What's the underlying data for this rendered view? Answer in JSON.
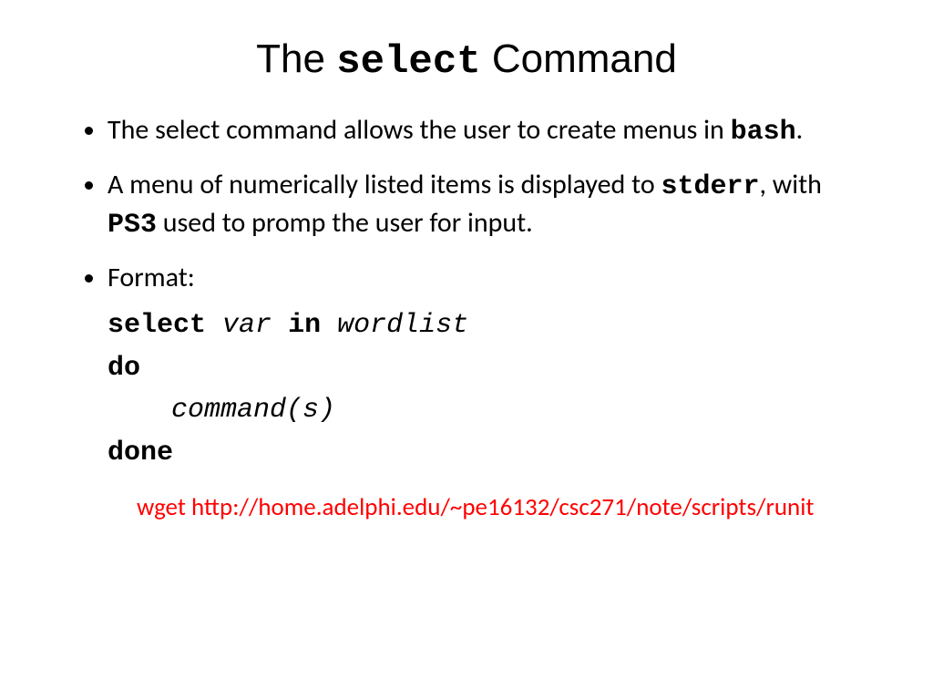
{
  "title": {
    "pre": "The ",
    "code": "select",
    "post": " Command"
  },
  "bullets": {
    "b1": {
      "t1": "The select command allows the user to create menus in ",
      "c1": "bash",
      "t2": "."
    },
    "b2": {
      "t1": "A menu of numerically listed items is displayed to ",
      "c1": "stderr",
      "t2": ", with ",
      "c2": "PS3",
      "t3": " used to promp the user for input."
    },
    "b3": {
      "t1": "Format:"
    }
  },
  "code": {
    "l1_kw1": "select",
    "l1_sp1": " ",
    "l1_it1": "var",
    "l1_sp2": " ",
    "l1_kw2": "in",
    "l1_sp3": " ",
    "l1_it2": "wordlist",
    "l2": "do",
    "l3": "command(s)",
    "l4": "done"
  },
  "footer": "wget http://home.adelphi.edu/~pe16132/csc271/note/scripts/runit"
}
